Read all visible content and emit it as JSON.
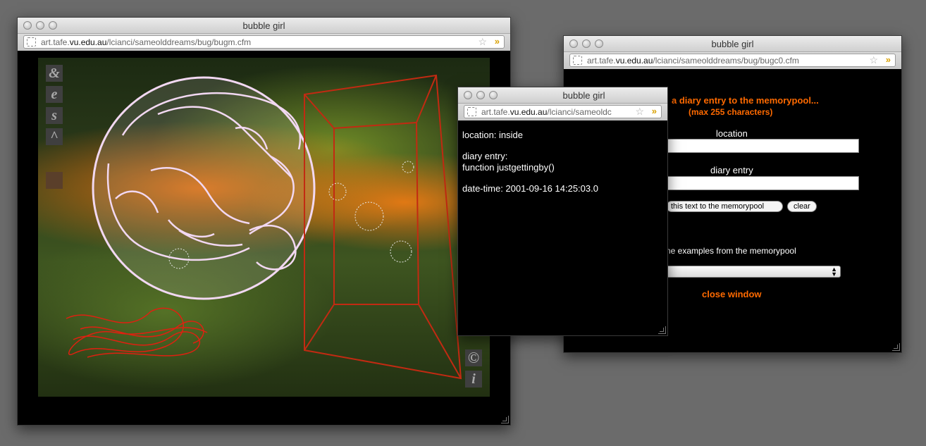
{
  "windows": {
    "art": {
      "title": "bubble girl",
      "url_pre": "art.tafe.",
      "url_host": "vu.edu.au",
      "url_post": "/lcianci/sameolddreams/bug/bugm.cfm",
      "side_icons": [
        "&",
        "e",
        "s",
        "^"
      ],
      "bottom_icons": [
        "©",
        "i"
      ]
    },
    "diary_form": {
      "title": "bubble girl",
      "url_pre": "art.tafe.",
      "url_host": "vu.edu.au",
      "url_post": "/lcianci/sameolddreams/bug/bugc0.cfm",
      "heading_line1": "a diary entry to the memorypool...",
      "heading_line2": "(max 255 characters)",
      "location_label": "location",
      "location_value": "",
      "diary_label": "diary entry",
      "diary_value": "",
      "submit_label": "this text to the memorypool",
      "clear_label": "clear",
      "examples_label": "ne examples from the memorypool",
      "examples_selected": "",
      "close_label": "close window"
    },
    "entry": {
      "title": "bubble girl",
      "url_pre": "art.tafe.",
      "url_host": "vu.edu.au",
      "url_post": "/lcianci/sameoldc",
      "location": "location: inside",
      "diary_heading": "diary entry:",
      "diary_text": "function justgettingby()",
      "datetime": "date-time: 2001-09-16 14:25:03.0"
    }
  },
  "colors": {
    "accent_orange": "#ff6a00",
    "desktop": "#6b6b6b"
  }
}
